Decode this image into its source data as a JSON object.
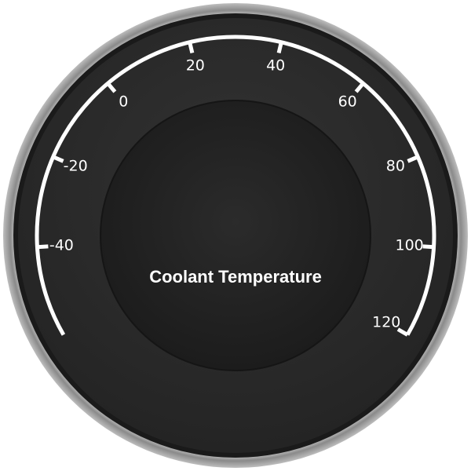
{
  "gauge": {
    "title": "Coolant Temperature",
    "scale": {
      "min": -60,
      "max": 120,
      "major_ticks": [
        -60,
        -40,
        -20,
        0,
        20,
        40,
        60,
        80,
        100,
        120
      ],
      "labels": [
        "-40",
        "-20",
        "0",
        "20",
        "40",
        "60",
        "80",
        "100",
        "120"
      ]
    },
    "colors": {
      "face": "#2a2a2a",
      "center": "#1f1f1f",
      "bezel": "#9a9a9a",
      "scale": "#ffffff",
      "text": "#ffffff"
    }
  }
}
